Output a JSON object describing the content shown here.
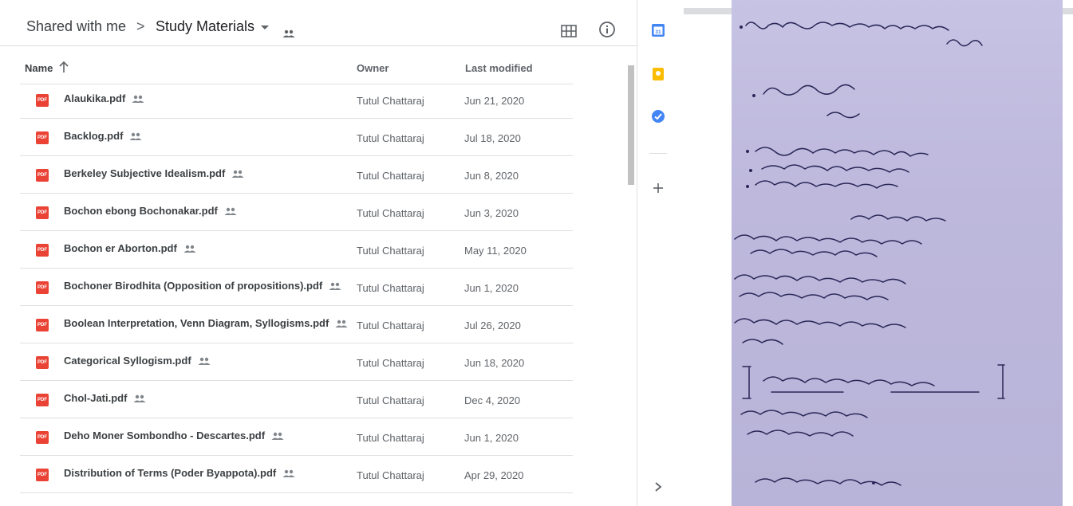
{
  "breadcrumb": {
    "root": "Shared with me",
    "separator": ">",
    "folder": "Study Materials"
  },
  "columns": {
    "name": "Name",
    "owner": "Owner",
    "last_modified": "Last modified"
  },
  "files": [
    {
      "name": "Alaukika.pdf",
      "owner": "Tutul Chattaraj",
      "modified": "Jun 21, 2020"
    },
    {
      "name": "Backlog.pdf",
      "owner": "Tutul Chattaraj",
      "modified": "Jul 18, 2020"
    },
    {
      "name": "Berkeley Subjective Idealism.pdf",
      "owner": "Tutul Chattaraj",
      "modified": "Jun 8, 2020"
    },
    {
      "name": "Bochon ebong Bochonakar.pdf",
      "owner": "Tutul Chattaraj",
      "modified": "Jun 3, 2020"
    },
    {
      "name": "Bochon er Aborton.pdf",
      "owner": "Tutul Chattaraj",
      "modified": "May 11, 2020"
    },
    {
      "name": "Bochoner Birodhita (Opposition of propositions).pdf",
      "owner": "Tutul Chattaraj",
      "modified": "Jun 1, 2020"
    },
    {
      "name": "Boolean Interpretation, Venn Diagram, Syllogisms.pdf",
      "owner": "Tutul Chattaraj",
      "modified": "Jul 26, 2020"
    },
    {
      "name": "Categorical Syllogism.pdf",
      "owner": "Tutul Chattaraj",
      "modified": "Jun 18, 2020"
    },
    {
      "name": "Chol-Jati.pdf",
      "owner": "Tutul Chattaraj",
      "modified": "Dec 4, 2020"
    },
    {
      "name": "Deho Moner Sombondho - Descartes.pdf",
      "owner": "Tutul Chattaraj",
      "modified": "Jun 1, 2020"
    },
    {
      "name": "Distribution of Terms (Poder Byappota).pdf",
      "owner": "Tutul Chattaraj",
      "modified": "Apr 29, 2020"
    }
  ],
  "file_icon_label": "PDF",
  "side_panel": {
    "calendar_label": "31",
    "icons": [
      "calendar-icon",
      "keep-icon",
      "tasks-icon",
      "add-icon",
      "chevron-right-icon"
    ]
  },
  "colors": {
    "pdf_red": "#ea4335",
    "calendar_blue": "#4285f4",
    "keep_yellow": "#fbbc04",
    "tasks_blue": "#4285f4"
  }
}
